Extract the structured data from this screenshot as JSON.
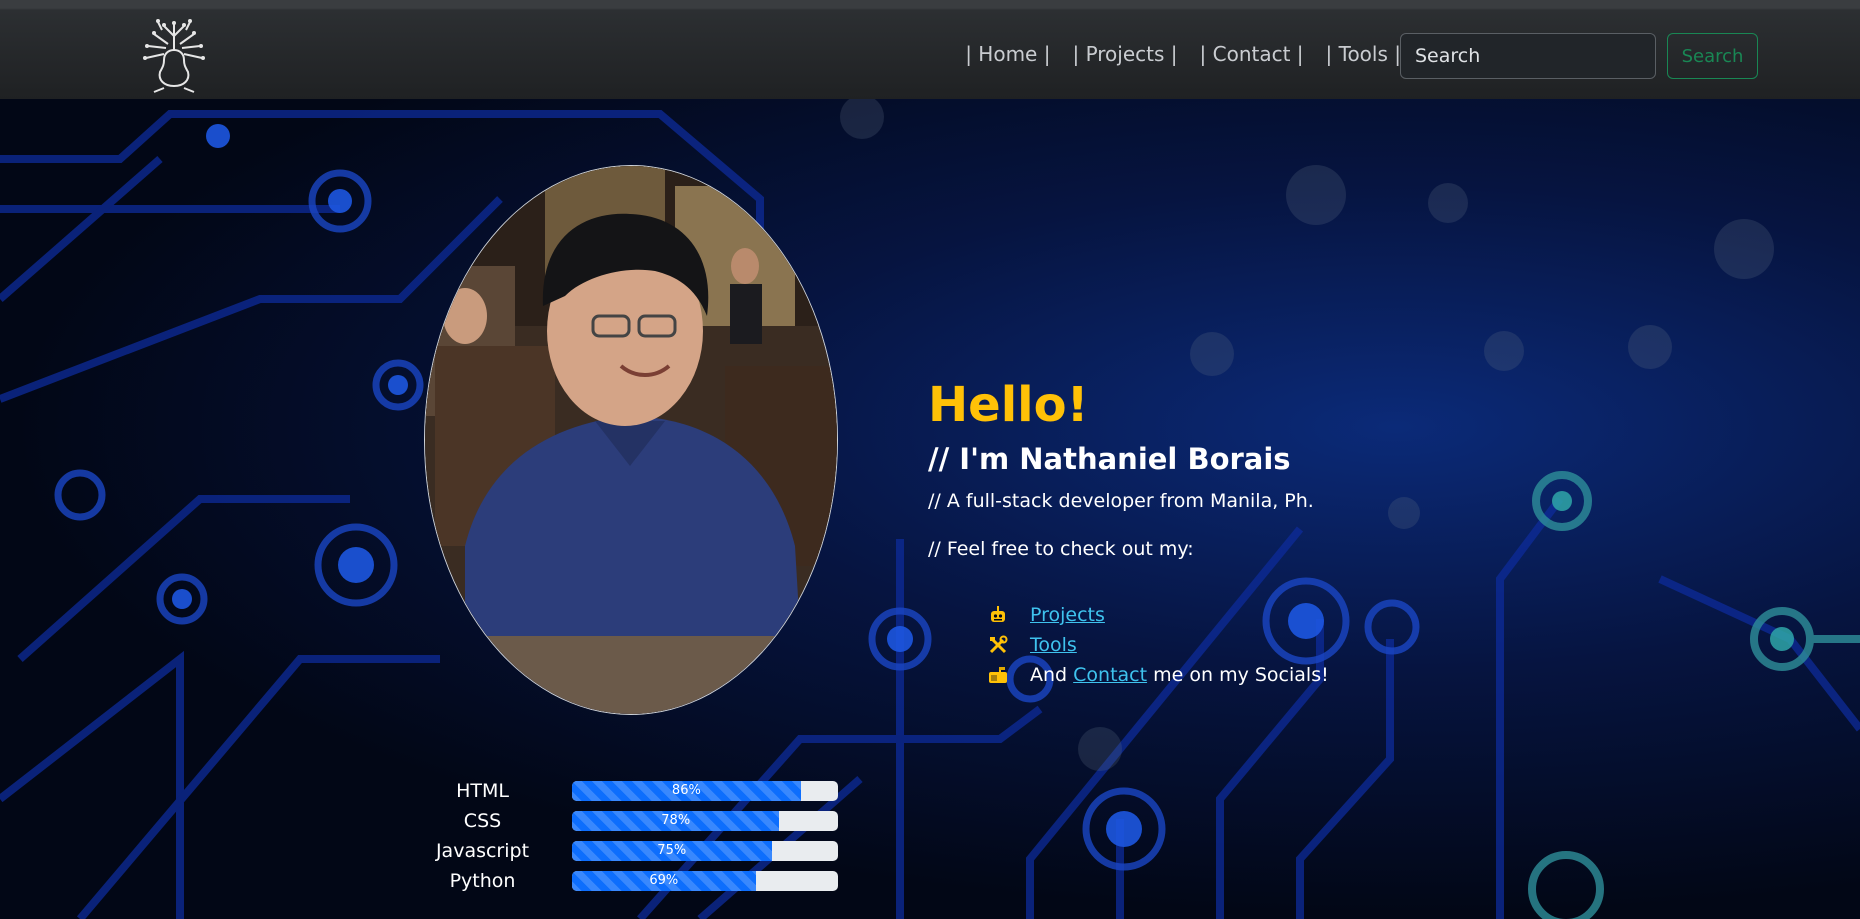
{
  "nav": {
    "logo_icon": "tree-head-icon",
    "links": [
      "| Home |",
      "| Projects |",
      "| Contact |",
      "| Tools |"
    ],
    "search_placeholder": "Search",
    "search_button": "Search"
  },
  "hero": {
    "hello": "Hello!",
    "name": "// I'm Nathaniel Borais",
    "tagline": "// A full-stack developer from Manila, Ph.",
    "checkout": "// Feel free to check out my:",
    "links": {
      "projects": "Projects",
      "tools": "Tools",
      "contact_prefix": "And",
      "contact": "Contact",
      "contact_suffix": "me on my Socials!"
    }
  },
  "skills": [
    {
      "name": "HTML",
      "percent": 86,
      "label": "86%"
    },
    {
      "name": "CSS",
      "percent": 78,
      "label": "78%"
    },
    {
      "name": "Javascript",
      "percent": 75,
      "label": "75%"
    },
    {
      "name": "Python",
      "percent": 69,
      "label": "69%"
    }
  ],
  "colors": {
    "accent": "#ffc107",
    "link": "#3fc3ee",
    "progress": "#0d6efd",
    "search_button": "#198754"
  }
}
